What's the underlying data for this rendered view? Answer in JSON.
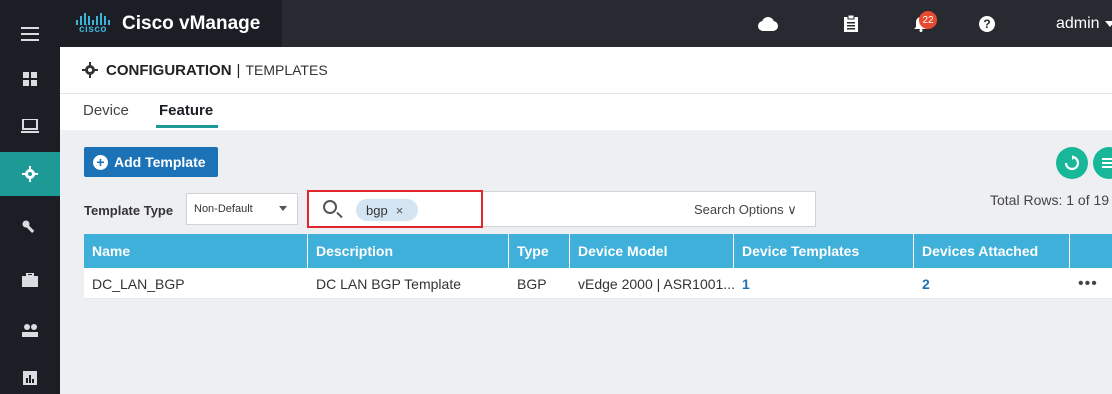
{
  "app": {
    "vendor_logo_text": "cisco",
    "title": "Cisco vManage",
    "notifications_count": "22",
    "user": "admin"
  },
  "rail": {
    "items": [
      "grid-icon",
      "laptop-icon",
      "gear-icon",
      "wrench-icon",
      "briefcase-icon",
      "users-icon",
      "chart-icon"
    ],
    "active": "gear-icon"
  },
  "page": {
    "section": "CONFIGURATION",
    "separator": "|",
    "subsection": "TEMPLATES"
  },
  "tabs": [
    {
      "label": "Device",
      "active": false
    },
    {
      "label": "Feature",
      "active": true
    }
  ],
  "toolbar": {
    "add_label": "Add Template",
    "template_type_label": "Template Type",
    "template_type_value": "Non-Default",
    "search_chip": "bgp",
    "search_chip_close": "×",
    "search_options_label": "Search Options",
    "search_options_caret": "∨",
    "total_rows": "Total Rows: 1 of 19"
  },
  "table": {
    "columns": [
      "Name",
      "Description",
      "Type",
      "Device Model",
      "Device Templates",
      "Devices Attached",
      ""
    ],
    "rows": [
      {
        "name": "DC_LAN_BGP",
        "description": "DC LAN BGP Template",
        "type": "BGP",
        "device_model": "vEdge 2000 | ASR1001...",
        "device_templates": "1",
        "devices_attached": "2",
        "actions": "•••"
      }
    ]
  },
  "colors": {
    "accent": "#1d9a96",
    "header_blue": "#3fb0d9",
    "button_blue": "#1c72b7",
    "highlight_red": "#e2262b"
  }
}
